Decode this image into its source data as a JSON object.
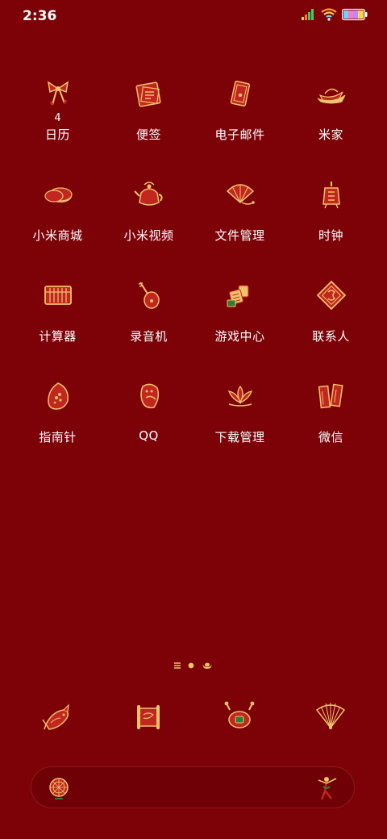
{
  "status_bar": {
    "time": "2:36",
    "icons": [
      "signal-icon",
      "wifi-icon",
      "battery-icon"
    ]
  },
  "apps": [
    {
      "label": "日历",
      "badge": "4",
      "icon": "calendar-bow-icon"
    },
    {
      "label": "便签",
      "badge": "",
      "icon": "notes-icon"
    },
    {
      "label": "电子邮件",
      "badge": "",
      "icon": "email-envelope-icon"
    },
    {
      "label": "米家",
      "badge": "",
      "icon": "mijia-boat-icon"
    },
    {
      "label": "小米商城",
      "badge": "",
      "icon": "mi-store-mooncake-icon"
    },
    {
      "label": "小米视频",
      "badge": "",
      "icon": "mi-video-teapot-icon"
    },
    {
      "label": "文件管理",
      "badge": "",
      "icon": "file-manager-fan-icon"
    },
    {
      "label": "时钟",
      "badge": "",
      "icon": "clock-lantern-icon"
    },
    {
      "label": "计算器",
      "badge": "",
      "icon": "calculator-abacus-icon"
    },
    {
      "label": "录音机",
      "badge": "",
      "icon": "recorder-pipa-icon"
    },
    {
      "label": "游戏中心",
      "badge": "",
      "icon": "game-center-mahjong-icon"
    },
    {
      "label": "联系人",
      "badge": "",
      "icon": "contacts-diamond-icon"
    },
    {
      "label": "指南针",
      "badge": "",
      "icon": "compass-egg-icon"
    },
    {
      "label": "QQ",
      "badge": "",
      "icon": "qq-penguin-icon"
    },
    {
      "label": "下载管理",
      "badge": "",
      "icon": "download-lotus-icon"
    },
    {
      "label": "微信",
      "badge": "",
      "icon": "wechat-couplet-icon"
    }
  ],
  "page_indicator": {
    "pages": [
      "menu-icon",
      "dot-icon",
      "ingot-icon"
    ],
    "active": 1
  },
  "dock": [
    {
      "icon": "phone-koi-icon"
    },
    {
      "icon": "messages-scroll-icon"
    },
    {
      "icon": "browser-drum-icon"
    },
    {
      "icon": "camera-fan-icon"
    }
  ],
  "search_bar": {
    "left_icon": "wheel-icon",
    "right_icon": "dancer-icon"
  },
  "colors": {
    "background": "#7d0208",
    "icon_red": "#c2271f",
    "icon_gold": "#f0c26a",
    "label_white": "#ffffff"
  }
}
